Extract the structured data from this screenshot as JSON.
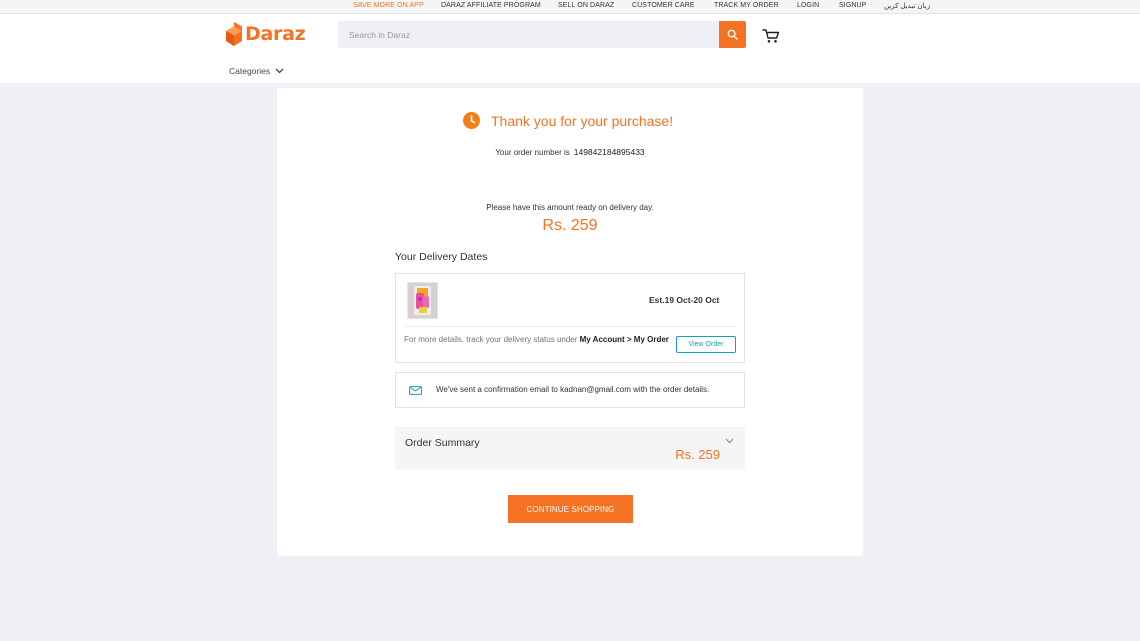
{
  "topbar": {
    "links": [
      {
        "label": "SAVE MORE ON APP"
      },
      {
        "label": "DARAZ AFFILIATE PROGRAM"
      },
      {
        "label": "SELL ON DARAZ"
      },
      {
        "label": "CUSTOMER CARE"
      },
      {
        "label": "TRACK MY ORDER"
      },
      {
        "label": "LOGIN"
      },
      {
        "label": "SIGNUP"
      },
      {
        "label": "زبان تبدیل کریں"
      }
    ],
    "accent_color": "#f57224"
  },
  "header": {
    "logo_text": "Daraz",
    "search_placeholder": "Search in Daraz",
    "search_icon": "search-icon",
    "cart_icon": "cart-icon",
    "categories_label": "Categories"
  },
  "confirmation": {
    "thanks_icon": "clock-icon",
    "thanks_text": "Thank you for your purchase!",
    "order_number_label": "Your order number is",
    "order_number": "149842184895433",
    "amount_note": "Please have this amount ready on delivery day.",
    "amount": "Rs. 259"
  },
  "delivery": {
    "title": "Your Delivery Dates",
    "estimate": "Est.19 Oct-20 Oct",
    "track_prefix": "For more details, track your delivery status under",
    "track_link_text": "My Account > My Order",
    "view_order_label": "View Order"
  },
  "email": {
    "icon": "mail-icon",
    "text": "We've sent a confirmation email to kadnan@gmail.com with the order details."
  },
  "summary": {
    "title": "Order Summary",
    "amount": "Rs. 259",
    "chevron_icon": "chevron-down-icon"
  },
  "actions": {
    "continue_label": "CONTINUE SHOPPING"
  },
  "colors": {
    "brand": "#f57224",
    "link": "#1a9cb7",
    "background": "#eff0f5"
  }
}
